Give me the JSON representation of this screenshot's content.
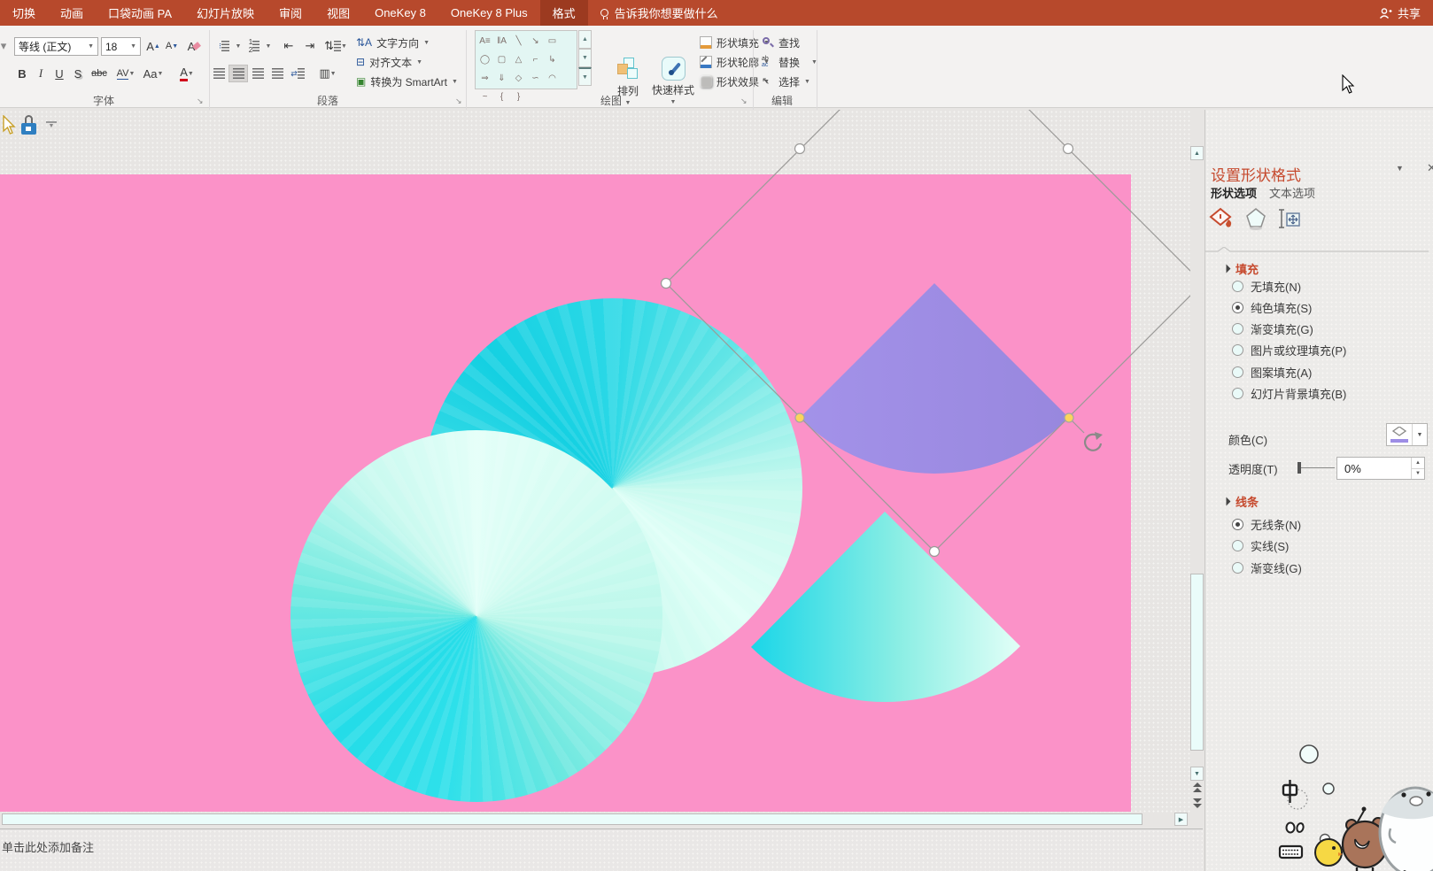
{
  "menubar": {
    "tabs": [
      "切换",
      "动画",
      "口袋动画 PA",
      "幻灯片放映",
      "审阅",
      "视图",
      "OneKey 8",
      "OneKey 8 Plus",
      "格式"
    ],
    "active_tab": "格式",
    "tell_me": "告诉我你想要做什么",
    "share": "共享"
  },
  "ribbon": {
    "font_group": {
      "label": "字体",
      "font_name": "等线 (正文)",
      "font_size": "18",
      "bold": "B",
      "italic": "I",
      "underline": "U",
      "shadow": "S",
      "strikethrough": "abc",
      "char_spacing": "AV",
      "change_case": "Aa",
      "font_color": "A"
    },
    "paragraph_group": {
      "label": "段落",
      "text_direction": "文字方向",
      "align_text": "对齐文本",
      "convert_smartart": "转换为 SmartArt"
    },
    "drawing_group": {
      "label": "绘图",
      "gallery_glyphs": [
        "A≡",
        "‖A",
        "╲",
        "↘",
        "▭",
        "◯",
        "▢",
        "△",
        "⌐",
        "↳",
        "⇒",
        "⇓",
        "◇",
        "∽",
        "◠",
        "~",
        "{",
        "}"
      ],
      "arrange": "排列",
      "quick_styles": "快速样式",
      "shape_fill": "形状填充",
      "shape_outline": "形状轮廓",
      "shape_effects": "形状效果"
    },
    "editing_group": {
      "label": "编辑",
      "find": "查找",
      "replace": "替换",
      "select": "选择"
    }
  },
  "panel": {
    "title": "设置形状格式",
    "tabs": [
      {
        "label": "形状选项",
        "active": true
      },
      {
        "label": "文本选项",
        "active": false
      }
    ],
    "icon_tabs": [
      "fill-line",
      "effects",
      "size-properties"
    ],
    "fill_section": {
      "title": "填充",
      "options": [
        {
          "label": "无填充(N)",
          "selected": false
        },
        {
          "label": "纯色填充(S)",
          "selected": true
        },
        {
          "label": "渐变填充(G)",
          "selected": false
        },
        {
          "label": "图片或纹理填充(P)",
          "selected": false
        },
        {
          "label": "图案填充(A)",
          "selected": false
        },
        {
          "label": "幻灯片背景填充(B)",
          "selected": false
        }
      ],
      "color_label": "颜色(C)",
      "transparency_label": "透明度(T)",
      "transparency_value": "0%"
    },
    "line_section": {
      "title": "线条",
      "options": [
        {
          "label": "无线条(N)",
          "selected": true
        },
        {
          "label": "实线(S)",
          "selected": false
        },
        {
          "label": "渐变线(G)",
          "selected": false
        }
      ]
    }
  },
  "notes": {
    "placeholder": "单击此处添加备注"
  },
  "colors": {
    "titlebar": "#b7492c",
    "active_tab_bg": "#9c3a20",
    "ribbon_bg": "#f3f2f1",
    "canvas_bg": "#e7e5e3",
    "slide_pink": "#fb92c8",
    "shape_purple": "#9d8de5",
    "shape_cyan_dark": "#14d0e2",
    "shape_cyan_light": "#e2fff7",
    "panel_title": "#c64a2e",
    "selection_handle_yellow": "#fbd45c",
    "color_swatch": "#9d8de5"
  }
}
